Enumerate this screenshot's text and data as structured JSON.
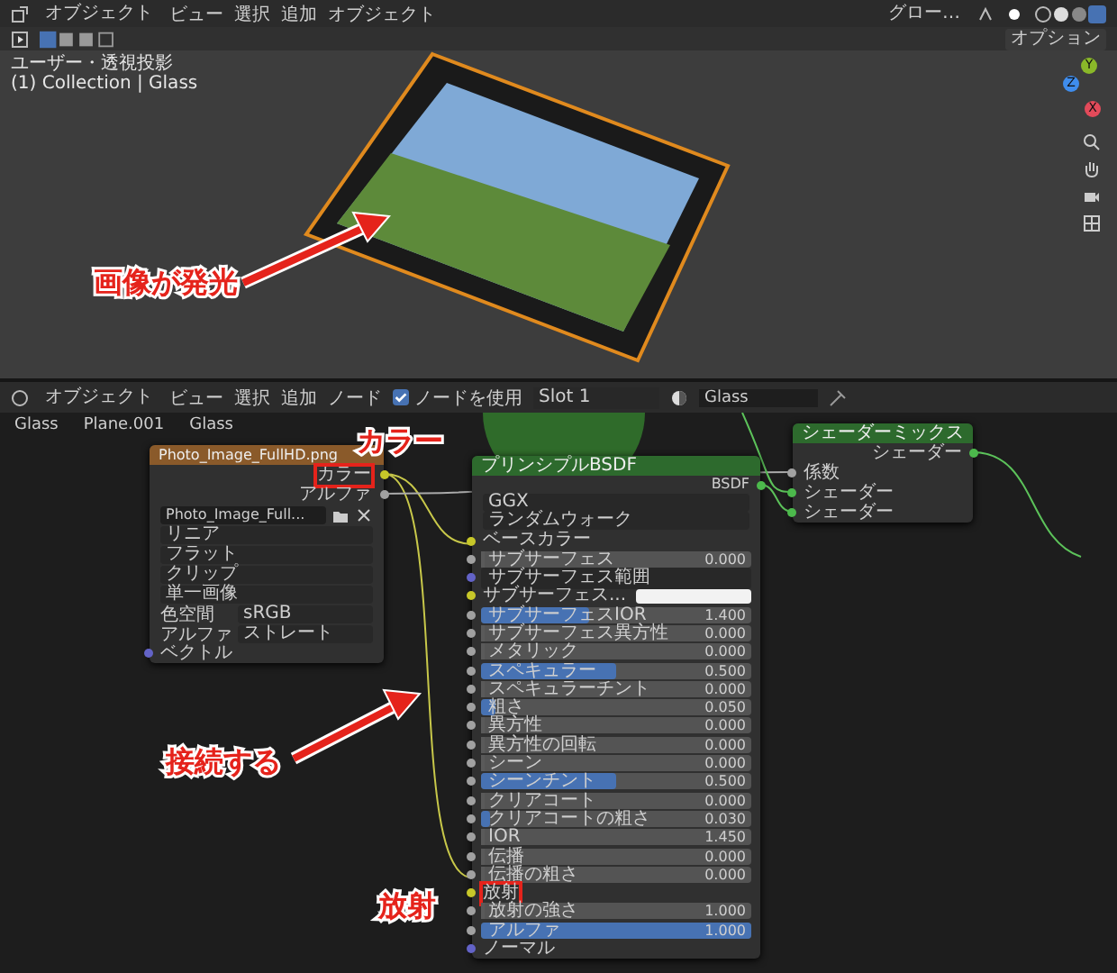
{
  "viewport": {
    "header": {
      "mode": "オブジェクト",
      "menus": [
        "ビュー",
        "選択",
        "追加",
        "オブジェクト"
      ],
      "orientation": "グロー…",
      "options": "オプション"
    },
    "view_name": "ユーザー・透視投影",
    "collection": "(1) Collection | Glass",
    "gizmo_axes": [
      "Y",
      "Z",
      "X"
    ]
  },
  "node_editor": {
    "header": {
      "mode": "オブジェクト",
      "menus": [
        "ビュー",
        "選択",
        "追加",
        "ノード"
      ],
      "use_nodes": {
        "label": "ノードを使用",
        "checked": true
      },
      "slot": "Slot 1",
      "material": "Glass"
    },
    "breadcrumb": [
      "Glass",
      "Plane.001",
      "Glass"
    ],
    "image_node": {
      "title": "Photo_Image_FullHD.png",
      "outputs": [
        {
          "label": "カラー",
          "kind": "color",
          "boxed": true
        },
        {
          "label": "アルファ",
          "kind": "float",
          "boxed": false
        }
      ],
      "image": "Photo_Image_Full...",
      "dropdowns": [
        "リニア",
        "フラット",
        "クリップ",
        "単一画像"
      ],
      "props": [
        {
          "label": "色空間",
          "value": "sRGB"
        },
        {
          "label": "アルファ",
          "value": "ストレート"
        }
      ],
      "inputs": [
        "ベクトル"
      ]
    },
    "principled": {
      "title": "プリンシプルBSDF",
      "output": "BSDF",
      "dropdowns": [
        "GGX",
        "ランダムウォーク"
      ],
      "inputs": [
        {
          "kind": "color_input",
          "label": "ベースカラー",
          "boxed": false
        },
        {
          "kind": "slider",
          "label": "サブサーフェス",
          "value": "0.000",
          "level": 0,
          "boxed": false
        },
        {
          "kind": "dropdown",
          "label": "サブサーフェス範囲",
          "boxed": false
        },
        {
          "kind": "color_field",
          "label": "サブサーフェス...",
          "boxed": false
        },
        {
          "kind": "slider",
          "label": "サブサーフェスIOR",
          "value": "1.400",
          "level": 0.4,
          "boxed": false
        },
        {
          "kind": "slider",
          "label": "サブサーフェス異方性",
          "value": "0.000",
          "level": 0,
          "boxed": false
        },
        {
          "kind": "slider",
          "label": "メタリック",
          "value": "0.000",
          "level": 0,
          "boxed": false
        },
        {
          "kind": "slider",
          "label": "スペキュラー",
          "value": "0.500",
          "level": 0.5,
          "boxed": false
        },
        {
          "kind": "slider",
          "label": "スペキュラーチント",
          "value": "0.000",
          "level": 0,
          "boxed": false
        },
        {
          "kind": "slider",
          "label": "粗さ",
          "value": "0.050",
          "level": 0.05,
          "boxed": false
        },
        {
          "kind": "slider",
          "label": "異方性",
          "value": "0.000",
          "level": 0,
          "boxed": false
        },
        {
          "kind": "slider",
          "label": "異方性の回転",
          "value": "0.000",
          "level": 0,
          "boxed": false
        },
        {
          "kind": "slider",
          "label": "シーン",
          "value": "0.000",
          "level": 0,
          "boxed": false
        },
        {
          "kind": "slider",
          "label": "シーンチント",
          "value": "0.500",
          "level": 0.5,
          "boxed": false
        },
        {
          "kind": "slider",
          "label": "クリアコート",
          "value": "0.000",
          "level": 0,
          "boxed": false
        },
        {
          "kind": "slider",
          "label": "クリアコートの粗さ",
          "value": "0.030",
          "level": 0.03,
          "boxed": false
        },
        {
          "kind": "slider",
          "label": "IOR",
          "value": "1.450",
          "level": 0,
          "boxed": false
        },
        {
          "kind": "slider",
          "label": "伝播",
          "value": "0.000",
          "level": 0,
          "boxed": false
        },
        {
          "kind": "slider",
          "label": "伝播の粗さ",
          "value": "0.000",
          "level": 0,
          "boxed": false
        },
        {
          "kind": "color_input",
          "label": "放射",
          "boxed": true
        },
        {
          "kind": "slider",
          "label": "放射の強さ",
          "value": "1.000",
          "level": 0,
          "boxed": false
        },
        {
          "kind": "slider",
          "label": "アルファ",
          "value": "1.000",
          "level": 1,
          "boxed": false
        },
        {
          "kind": "vector_input",
          "label": "ノーマル",
          "boxed": false
        }
      ]
    },
    "mix_node": {
      "title": "シェーダーミックス",
      "output": "シェーダー",
      "inputs": [
        {
          "label": "係数",
          "kind": "float"
        },
        {
          "label": "シェーダー",
          "kind": "shader"
        },
        {
          "label": "シェーダー",
          "kind": "shader"
        }
      ]
    }
  },
  "annotations": [
    {
      "text": "画像が発光"
    },
    {
      "text": "カラー"
    },
    {
      "text": "接続する"
    },
    {
      "text": "放射"
    }
  ]
}
